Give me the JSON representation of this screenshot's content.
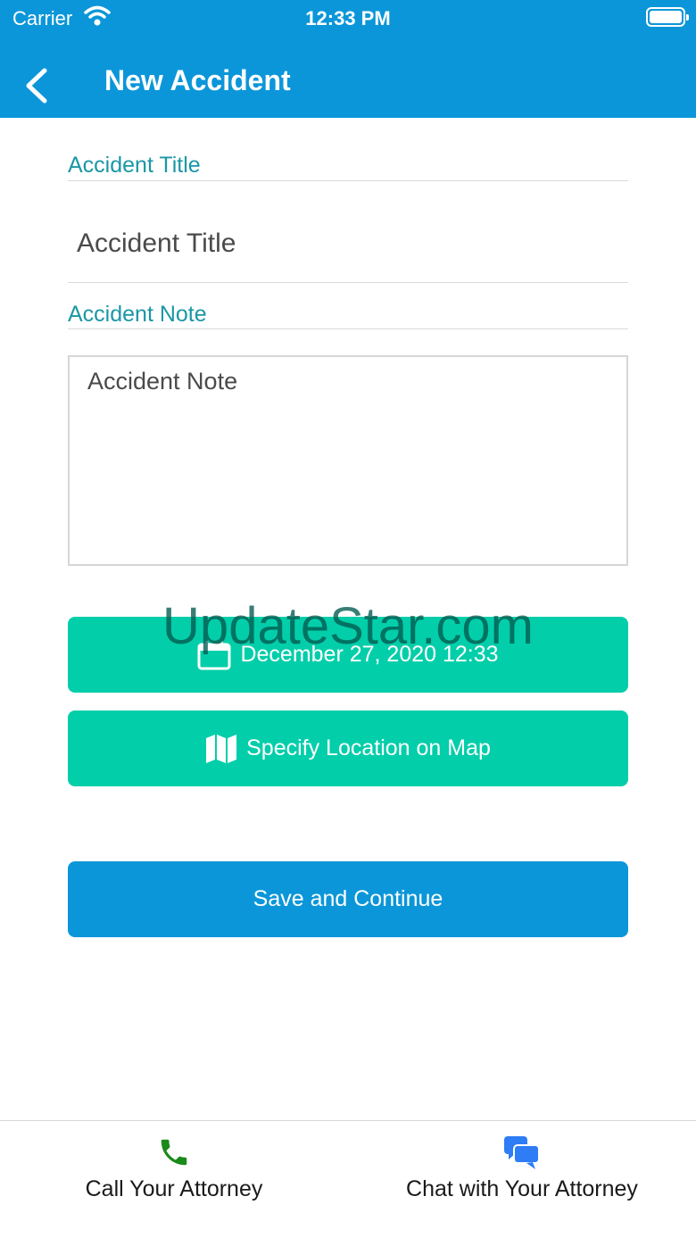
{
  "status_bar": {
    "carrier": "Carrier",
    "time": "12:33 PM"
  },
  "header": {
    "title": "New Accident",
    "back_icon": "chevron-left-icon"
  },
  "form": {
    "title_label": "Accident Title",
    "title_placeholder": "Accident Title",
    "note_label": "Accident Note",
    "note_placeholder": "Accident Note",
    "date_button": "December 27, 2020 12:33",
    "date_icon": "calendar-icon",
    "location_button": "Specify Location on Map",
    "location_icon": "map-icon",
    "save_button": "Save and Continue"
  },
  "watermark": "UpdateStar.com",
  "tab_bar": {
    "call": {
      "label": "Call Your Attorney",
      "icon": "phone-icon"
    },
    "chat": {
      "label": "Chat with Your Attorney",
      "icon": "chat-bubbles-icon"
    }
  },
  "colors": {
    "primary_blue": "#0b96d9",
    "accent_green": "#03ceaa",
    "label_teal": "#1a97a6",
    "phone_green": "#1a8a1a",
    "chat_blue": "#2e7cf6"
  }
}
